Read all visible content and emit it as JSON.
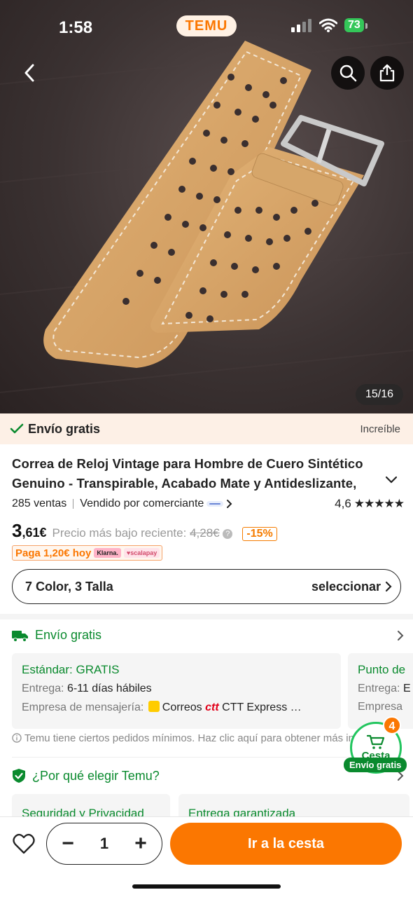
{
  "status_bar": {
    "time": "1:58",
    "app_logo": "TEMU",
    "battery": "73"
  },
  "gallery": {
    "counter": "15/16",
    "image_desc_icon": "watch-strap-photo"
  },
  "shipping_banner": {
    "label": "Envío gratis",
    "badge": "Increíble"
  },
  "product": {
    "title": "Correa de Reloj Vintage para Hombre de Cuero Sintético Genuino - Transpirable, Acabado Mate y Antideslizante,",
    "sales": "285 ventas",
    "seller": "Vendido por comerciante",
    "rating": "4,6",
    "stars": "★★★★★",
    "price_int": "3",
    "price_dec": ",61€",
    "price_label": "Precio más bajo reciente:",
    "price_old": "4,28€",
    "discount": "-15%",
    "pay_today": "Paga 1,20€ hoy",
    "pay_chips": [
      "Klarna.",
      "♥scalapay"
    ]
  },
  "variant": {
    "label": "7 Color, 3 Talla",
    "action": "seleccionar"
  },
  "shipping_section": {
    "title": "Envío gratis",
    "cards": [
      {
        "title": "Estándar: GRATIS",
        "delivery_label": "Entrega:",
        "delivery_value": "6-11 días hábiles",
        "courier_label": "Empresa de mensajería:",
        "courier_value": "Correos",
        "courier_ctt": "ctt",
        "courier_rest": "CTT Express …"
      },
      {
        "title": "Punto de",
        "delivery_label": "Entrega:",
        "delivery_value": "E",
        "courier_label": "Empresa"
      }
    ],
    "notice": "Temu tiene ciertos pedidos mínimos. Haz clic aquí para obtener más información."
  },
  "cart_float": {
    "label": "Cesta",
    "count": "4",
    "shipping": "Envío gratis"
  },
  "why_section": {
    "title": "¿Por qué elegir Temu?",
    "cards": [
      "Seguridad y Privacidad",
      "Entrega garantizada"
    ]
  },
  "bottom_bar": {
    "quantity": "1",
    "cta": "Ir a la cesta"
  },
  "colors": {
    "accent": "#fb7701",
    "green": "#0a8a2e",
    "banner_bg": "#fdf0e6"
  }
}
